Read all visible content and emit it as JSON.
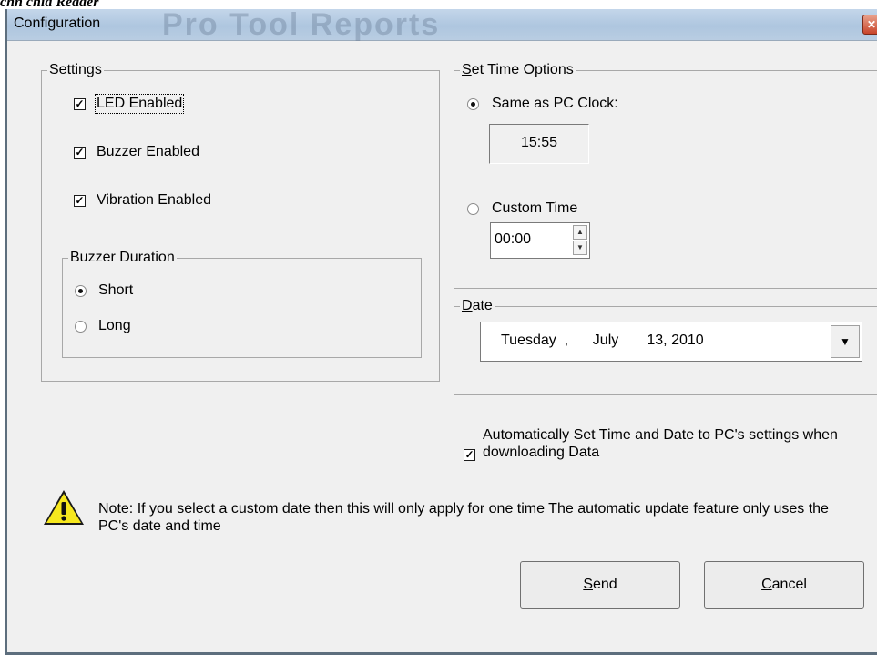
{
  "page": {
    "caption": "chn chia Reader"
  },
  "window": {
    "title": "Configuration",
    "watermark": "Pro Tool Reports",
    "close_icon": "close-icon"
  },
  "settings": {
    "legend": "Settings",
    "checkboxes": [
      {
        "label": "LED Enabled",
        "checked": true
      },
      {
        "label": "Buzzer Enabled",
        "checked": true
      },
      {
        "label": "Vibration Enabled",
        "checked": true
      }
    ],
    "buzzer": {
      "legend": "Buzzer Duration",
      "options": [
        {
          "label": "Short",
          "selected": true
        },
        {
          "label": "Long",
          "selected": false
        }
      ]
    }
  },
  "time_options": {
    "legend_accel": "S",
    "legend_rest": "et Time Options",
    "same_as_pc_label": "Same as PC Clock:",
    "same_as_pc_selected": true,
    "pc_clock_value": "15:55",
    "custom_label": "Custom Time",
    "custom_selected": false,
    "custom_value": "00:00"
  },
  "date": {
    "legend_accel": "D",
    "legend_rest": "ate",
    "weekday": "Tuesday",
    "sep": ",",
    "month": "July",
    "day_year": "13, 2010"
  },
  "auto_sync": {
    "checked": true,
    "label": "Automatically Set Time and Date to PC's settings when downloading Data"
  },
  "note": {
    "icon": "warning-icon",
    "text": "Note: If you select a custom date then this will only apply for one time The automatic update feature only uses the PC's date and time"
  },
  "buttons": {
    "send_accel": "S",
    "send_rest": "end",
    "cancel_accel": "C",
    "cancel_rest": "ancel"
  }
}
